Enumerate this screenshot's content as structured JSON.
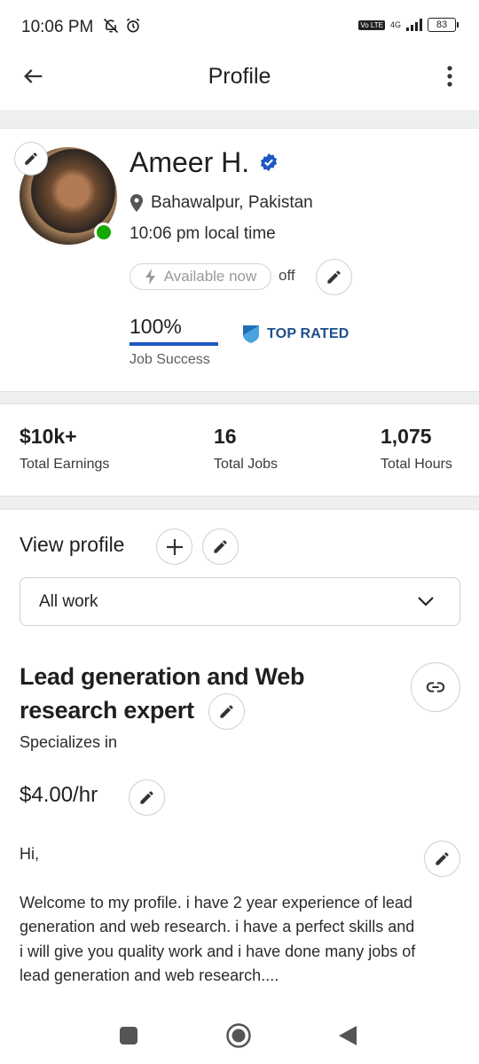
{
  "status_bar": {
    "time": "10:06 PM",
    "network": "4G",
    "lte": "Vo LTE",
    "battery": "83"
  },
  "header": {
    "title": "Profile",
    "back_icon": "arrow-left-icon",
    "menu_icon": "more-vertical-icon"
  },
  "profile": {
    "name": "Ameer H.",
    "location": "Bahawalpur, Pakistan",
    "local_time": "10:06 pm local time",
    "availability_label": "Available now",
    "availability_state": "off",
    "job_success_value": "100%",
    "job_success_fraction": 1.0,
    "job_success_label": "Job Success",
    "badge": "TOP RATED",
    "online_color": "#14a800",
    "accent_color": "#1f57c3"
  },
  "stats": [
    {
      "value": "$10k+",
      "label": "Total Earnings"
    },
    {
      "value": "16",
      "label": "Total Jobs"
    },
    {
      "value": "1,075",
      "label": "Total Hours"
    }
  ],
  "portfolio": {
    "view_profile_label": "View profile",
    "select_value": "All work",
    "headline": "Lead generation and Web research expert",
    "specializes_label": "Specializes in",
    "rate": "$4.00/hr",
    "overview_greeting": "Hi,",
    "overview_text": "Welcome to my profile. i have 2 year experience of lead generation and web research. i have a perfect skills and i will give you quality work and i have done many jobs of lead generation and web research...."
  }
}
